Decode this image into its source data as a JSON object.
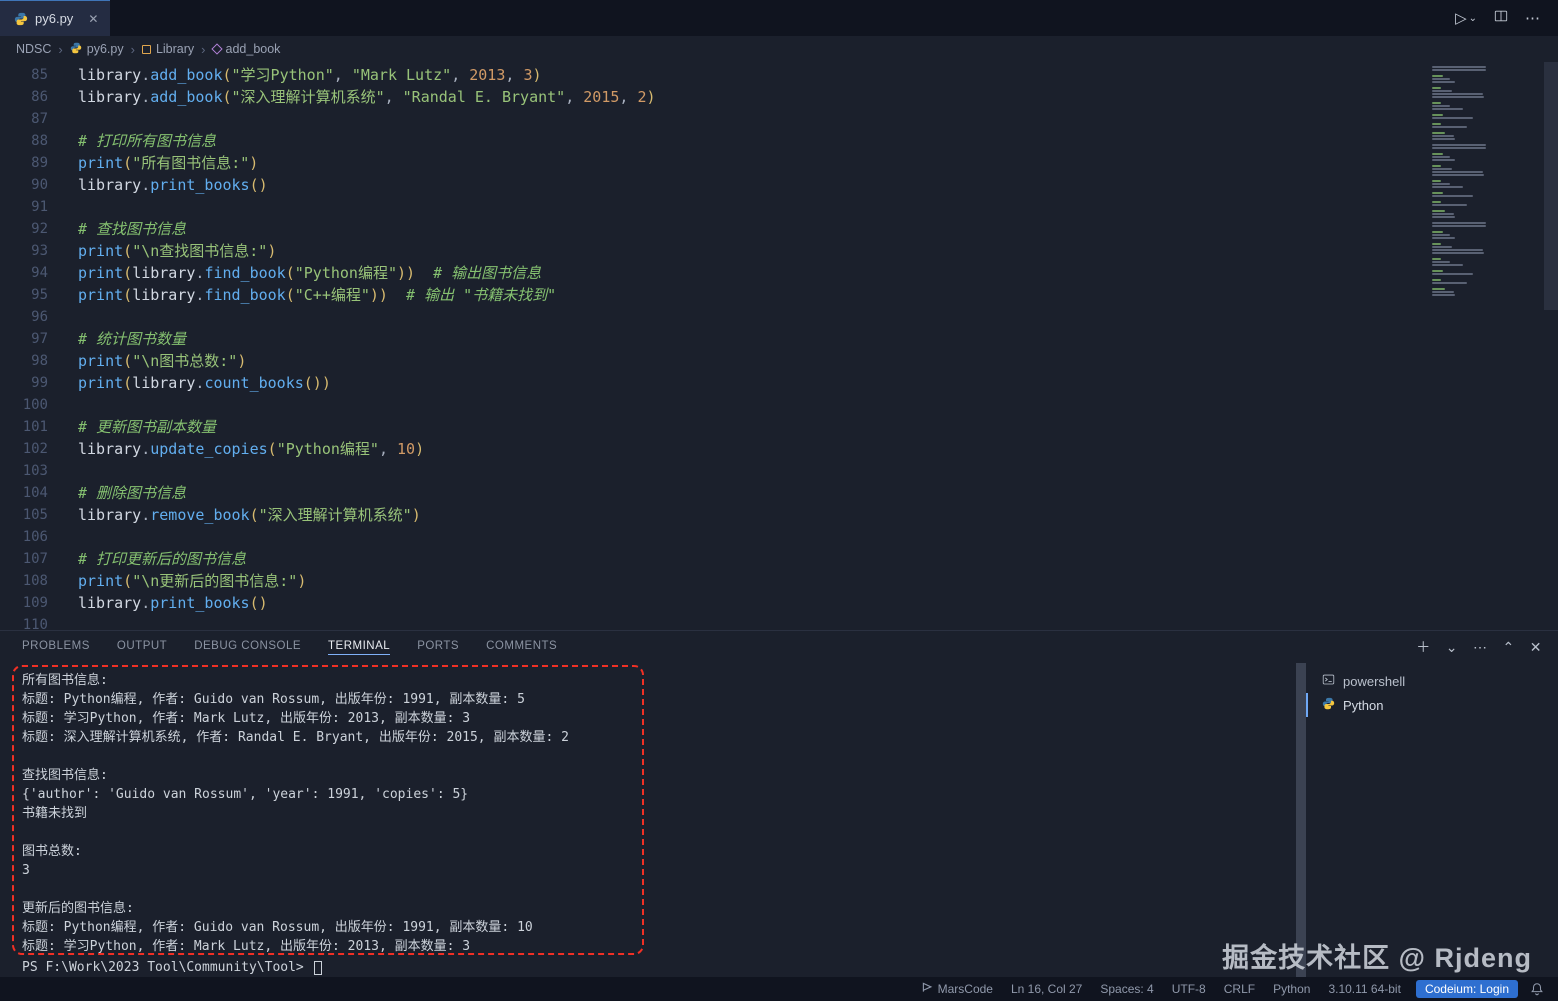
{
  "tabbar": {
    "tab_title": "py6.py",
    "close_glyph": "✕",
    "run_glyph": "▷",
    "run_caret_glyph": "⌄",
    "more_glyph": "⋯"
  },
  "breadcrumb": {
    "separator": "›",
    "items": [
      "NDSC",
      "py6.py",
      "Library",
      "add_book"
    ]
  },
  "editor": {
    "lines": [
      {
        "no": 85,
        "t": [
          [
            "v",
            "library"
          ],
          [
            "p",
            "."
          ],
          [
            "f",
            "add_book"
          ],
          [
            "b",
            "("
          ],
          [
            "s",
            "\"学习Python\""
          ],
          [
            "p",
            ", "
          ],
          [
            "s",
            "\"Mark Lutz\""
          ],
          [
            "p",
            ", "
          ],
          [
            "n",
            "2013"
          ],
          [
            "p",
            ", "
          ],
          [
            "n",
            "3"
          ],
          [
            "b",
            ")"
          ]
        ]
      },
      {
        "no": 86,
        "t": [
          [
            "v",
            "library"
          ],
          [
            "p",
            "."
          ],
          [
            "f",
            "add_book"
          ],
          [
            "b",
            "("
          ],
          [
            "s",
            "\"深入理解计算机系统\""
          ],
          [
            "p",
            ", "
          ],
          [
            "s",
            "\"Randal E. Bryant\""
          ],
          [
            "p",
            ", "
          ],
          [
            "n",
            "2015"
          ],
          [
            "p",
            ", "
          ],
          [
            "n",
            "2"
          ],
          [
            "b",
            ")"
          ]
        ]
      },
      {
        "no": 87,
        "t": []
      },
      {
        "no": 88,
        "t": [
          [
            "c",
            "# 打印所有图书信息"
          ]
        ]
      },
      {
        "no": 89,
        "t": [
          [
            "f",
            "print"
          ],
          [
            "b",
            "("
          ],
          [
            "s",
            "\"所有图书信息:\""
          ],
          [
            "b",
            ")"
          ]
        ]
      },
      {
        "no": 90,
        "t": [
          [
            "v",
            "library"
          ],
          [
            "p",
            "."
          ],
          [
            "f",
            "print_books"
          ],
          [
            "b",
            "()"
          ]
        ]
      },
      {
        "no": 91,
        "t": []
      },
      {
        "no": 92,
        "t": [
          [
            "c",
            "# 查找图书信息"
          ]
        ]
      },
      {
        "no": 93,
        "t": [
          [
            "f",
            "print"
          ],
          [
            "b",
            "("
          ],
          [
            "s",
            "\"\\n查找图书信息:\""
          ],
          [
            "b",
            ")"
          ]
        ]
      },
      {
        "no": 94,
        "t": [
          [
            "f",
            "print"
          ],
          [
            "b",
            "("
          ],
          [
            "v",
            "library"
          ],
          [
            "p",
            "."
          ],
          [
            "f",
            "find_book"
          ],
          [
            "b",
            "("
          ],
          [
            "s",
            "\"Python编程\""
          ],
          [
            "b",
            "))"
          ],
          [
            "c",
            "  # 输出图书信息"
          ]
        ]
      },
      {
        "no": 95,
        "t": [
          [
            "f",
            "print"
          ],
          [
            "b",
            "("
          ],
          [
            "v",
            "library"
          ],
          [
            "p",
            "."
          ],
          [
            "f",
            "find_book"
          ],
          [
            "b",
            "("
          ],
          [
            "s",
            "\"C++编程\""
          ],
          [
            "b",
            "))"
          ],
          [
            "c",
            "  # 输出 \"书籍未找到\""
          ]
        ]
      },
      {
        "no": 96,
        "t": []
      },
      {
        "no": 97,
        "t": [
          [
            "c",
            "# 统计图书数量"
          ]
        ]
      },
      {
        "no": 98,
        "t": [
          [
            "f",
            "print"
          ],
          [
            "b",
            "("
          ],
          [
            "s",
            "\"\\n图书总数:\""
          ],
          [
            "b",
            ")"
          ]
        ]
      },
      {
        "no": 99,
        "t": [
          [
            "f",
            "print"
          ],
          [
            "b",
            "("
          ],
          [
            "v",
            "library"
          ],
          [
            "p",
            "."
          ],
          [
            "f",
            "count_books"
          ],
          [
            "b",
            "())"
          ]
        ]
      },
      {
        "no": 100,
        "t": []
      },
      {
        "no": 101,
        "t": [
          [
            "c",
            "# 更新图书副本数量"
          ]
        ]
      },
      {
        "no": 102,
        "t": [
          [
            "v",
            "library"
          ],
          [
            "p",
            "."
          ],
          [
            "f",
            "update_copies"
          ],
          [
            "b",
            "("
          ],
          [
            "s",
            "\"Python编程\""
          ],
          [
            "p",
            ", "
          ],
          [
            "n",
            "10"
          ],
          [
            "b",
            ")"
          ]
        ]
      },
      {
        "no": 103,
        "t": []
      },
      {
        "no": 104,
        "t": [
          [
            "c",
            "# 删除图书信息"
          ]
        ]
      },
      {
        "no": 105,
        "t": [
          [
            "v",
            "library"
          ],
          [
            "p",
            "."
          ],
          [
            "f",
            "remove_book"
          ],
          [
            "b",
            "("
          ],
          [
            "s",
            "\"深入理解计算机系统\""
          ],
          [
            "b",
            ")"
          ]
        ]
      },
      {
        "no": 106,
        "t": []
      },
      {
        "no": 107,
        "t": [
          [
            "c",
            "# 打印更新后的图书信息"
          ]
        ]
      },
      {
        "no": 108,
        "t": [
          [
            "f",
            "print"
          ],
          [
            "b",
            "("
          ],
          [
            "s",
            "\"\\n更新后的图书信息:\""
          ],
          [
            "b",
            ")"
          ]
        ]
      },
      {
        "no": 109,
        "t": [
          [
            "v",
            "library"
          ],
          [
            "p",
            "."
          ],
          [
            "f",
            "print_books"
          ],
          [
            "b",
            "()"
          ]
        ]
      },
      {
        "no": 110,
        "t": []
      }
    ]
  },
  "panel": {
    "tabs": [
      "PROBLEMS",
      "OUTPUT",
      "DEBUG CONSOLE",
      "TERMINAL",
      "PORTS",
      "COMMENTS"
    ],
    "new_glyph": "＋",
    "dropdown_glyph": "⌄",
    "more_glyph": "⋯",
    "maximize_glyph": "⌃",
    "close_glyph": "✕"
  },
  "terminal": {
    "output_lines": [
      "所有图书信息:",
      "标题: Python编程, 作者: Guido van Rossum, 出版年份: 1991, 副本数量: 5",
      "标题: 学习Python, 作者: Mark Lutz, 出版年份: 2013, 副本数量: 3",
      "标题: 深入理解计算机系统, 作者: Randal E. Bryant, 出版年份: 2015, 副本数量: 2",
      "",
      "查找图书信息:",
      "{'author': 'Guido van Rossum', 'year': 1991, 'copies': 5}",
      "书籍未找到",
      "",
      "图书总数:",
      "3",
      "",
      "更新后的图书信息:",
      "标题: Python编程, 作者: Guido van Rossum, 出版年份: 1991, 副本数量: 10",
      "标题: 学习Python, 作者: Mark Lutz, 出版年份: 2013, 副本数量: 3"
    ],
    "prompt": "PS F:\\Work\\2023 Tool\\Community\\Tool> ",
    "processes": [
      {
        "label": "powershell"
      },
      {
        "label": "Python"
      }
    ]
  },
  "status_bar": {
    "marscode": "MarsCode",
    "cursor": "Ln 16, Col 27",
    "spaces": "Spaces: 4",
    "encoding": "UTF-8",
    "eol": "CRLF",
    "language": "Python",
    "interpreter": "3.10.11 64-bit",
    "codeium": "Codeium: Login"
  },
  "watermark": "掘金技术社区 @ Rjdeng"
}
